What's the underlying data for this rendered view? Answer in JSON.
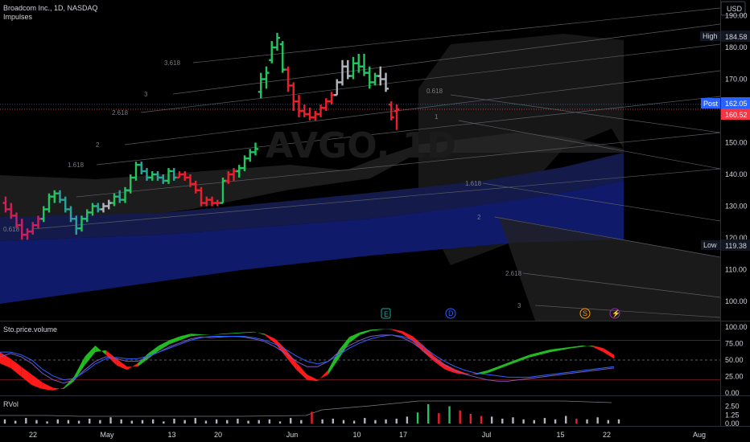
{
  "header": {
    "title": "Broadcom Inc., 1D, NASDAQ",
    "indicator": "Impulses",
    "currency": "USD",
    "watermark": "AVGO, 1D"
  },
  "tags": {
    "high_label": "High",
    "high_value": "184.58",
    "post_label": "Post",
    "post_value": "162.05",
    "last_value": "160.52",
    "low_label": "Low",
    "low_value": "119.38"
  },
  "fib_labels": {
    "up": [
      "0.618",
      "1",
      "1.618",
      "2",
      "2.618",
      "3",
      "3.618"
    ],
    "top": [
      "0.618",
      "1"
    ],
    "down": [
      "1.618",
      "2",
      "2.618",
      "3"
    ]
  },
  "events": {
    "earnings_icon": "E",
    "dividend_icon": "D",
    "split_icon": "S",
    "flash_icon": "⚡"
  },
  "panes": {
    "sto_label": "Sto.price.volume",
    "rvol_label": "RVol"
  },
  "colors": {
    "up": "#22c55e",
    "down": "#ef1c2b",
    "neutral": "#b2b5be",
    "pink": "#cf1f5b",
    "teal": "#26a69a",
    "navy": "#101a6b",
    "sto_green": "#22bb22",
    "sto_red": "#ff1a1a"
  },
  "chart_data": [
    {
      "type": "ohlc",
      "title": "Broadcom Inc., 1D, NASDAQ",
      "ylim": [
        95,
        197
      ],
      "yticks": [
        100,
        110,
        120,
        130,
        140,
        150,
        160,
        170,
        180,
        190
      ],
      "x_tick_labels": [
        "22",
        "May",
        "13",
        "20",
        "Jun",
        "10",
        "17",
        "Jul",
        "15",
        "22",
        "Aug"
      ],
      "x_tick_days": [
        0,
        8,
        15,
        20,
        28,
        35,
        40,
        49,
        57,
        62,
        72
      ],
      "price_lines": {
        "post": 162.05,
        "last": 160.52
      },
      "bars": [
        {
          "o": 131,
          "h": 133,
          "l": 128,
          "c": 129,
          "s": "pink"
        },
        {
          "o": 129,
          "h": 131,
          "l": 126,
          "c": 127,
          "s": "pink"
        },
        {
          "o": 127,
          "h": 128,
          "l": 123,
          "c": 124,
          "s": "pink"
        },
        {
          "o": 124,
          "h": 126,
          "l": 119.4,
          "c": 121,
          "s": "pink"
        },
        {
          "o": 121,
          "h": 123,
          "l": 119.4,
          "c": 122,
          "s": "pink"
        },
        {
          "o": 122,
          "h": 125,
          "l": 121,
          "c": 124,
          "s": "pink"
        },
        {
          "o": 124,
          "h": 127,
          "l": 123,
          "c": 126,
          "s": "pink"
        },
        {
          "o": 126,
          "h": 130,
          "l": 125,
          "c": 129,
          "s": "up"
        },
        {
          "o": 129,
          "h": 134,
          "l": 128,
          "c": 133,
          "s": "up"
        },
        {
          "o": 133,
          "h": 135,
          "l": 131,
          "c": 134,
          "s": "up"
        },
        {
          "o": 134,
          "h": 135,
          "l": 131,
          "c": 132,
          "s": "teal"
        },
        {
          "o": 132,
          "h": 133,
          "l": 128,
          "c": 129,
          "s": "teal"
        },
        {
          "o": 129,
          "h": 130,
          "l": 125,
          "c": 126,
          "s": "teal"
        },
        {
          "o": 126,
          "h": 127,
          "l": 121,
          "c": 123,
          "s": "teal"
        },
        {
          "o": 123,
          "h": 127,
          "l": 122,
          "c": 126,
          "s": "up"
        },
        {
          "o": 126,
          "h": 129,
          "l": 125,
          "c": 128,
          "s": "up"
        },
        {
          "o": 128,
          "h": 131,
          "l": 127,
          "c": 130,
          "s": "up"
        },
        {
          "o": 130,
          "h": 131,
          "l": 128,
          "c": 129,
          "s": "teal"
        },
        {
          "o": 129,
          "h": 131,
          "l": 128,
          "c": 130,
          "s": "neutral"
        },
        {
          "o": 130,
          "h": 132,
          "l": 129,
          "c": 131,
          "s": "neutral"
        },
        {
          "o": 131,
          "h": 134,
          "l": 130,
          "c": 133,
          "s": "up"
        },
        {
          "o": 133,
          "h": 135,
          "l": 131,
          "c": 132,
          "s": "teal"
        },
        {
          "o": 132,
          "h": 136,
          "l": 131,
          "c": 135,
          "s": "up"
        },
        {
          "o": 135,
          "h": 140,
          "l": 134,
          "c": 139,
          "s": "up"
        },
        {
          "o": 139,
          "h": 144,
          "l": 138,
          "c": 143,
          "s": "up"
        },
        {
          "o": 143,
          "h": 144,
          "l": 140,
          "c": 141,
          "s": "teal"
        },
        {
          "o": 141,
          "h": 142,
          "l": 138,
          "c": 139,
          "s": "teal"
        },
        {
          "o": 139,
          "h": 141,
          "l": 138,
          "c": 140,
          "s": "up"
        },
        {
          "o": 140,
          "h": 141,
          "l": 138,
          "c": 139,
          "s": "teal"
        },
        {
          "o": 139,
          "h": 140,
          "l": 137,
          "c": 138,
          "s": "teal"
        },
        {
          "o": 138,
          "h": 142,
          "l": 137,
          "c": 141,
          "s": "up"
        },
        {
          "o": 141,
          "h": 142,
          "l": 138,
          "c": 139,
          "s": "teal"
        },
        {
          "o": 139,
          "h": 141,
          "l": 139,
          "c": 140,
          "s": "down"
        },
        {
          "o": 140,
          "h": 141,
          "l": 138,
          "c": 139,
          "s": "down"
        },
        {
          "o": 139,
          "h": 140,
          "l": 136,
          "c": 137,
          "s": "down"
        },
        {
          "o": 137,
          "h": 138,
          "l": 134,
          "c": 135,
          "s": "down"
        },
        {
          "o": 135,
          "h": 136,
          "l": 130,
          "c": 131,
          "s": "down"
        },
        {
          "o": 131,
          "h": 133,
          "l": 130,
          "c": 132,
          "s": "down"
        },
        {
          "o": 132,
          "h": 133,
          "l": 130,
          "c": 131,
          "s": "down"
        },
        {
          "o": 131,
          "h": 132,
          "l": 130,
          "c": 131,
          "s": "down"
        },
        {
          "o": 131,
          "h": 139,
          "l": 131,
          "c": 138,
          "s": "up"
        },
        {
          "o": 138,
          "h": 141,
          "l": 137,
          "c": 140,
          "s": "down"
        },
        {
          "o": 140,
          "h": 142,
          "l": 138,
          "c": 141,
          "s": "down"
        },
        {
          "o": 141,
          "h": 143,
          "l": 139,
          "c": 142,
          "s": "up"
        },
        {
          "o": 142,
          "h": 146,
          "l": 141,
          "c": 145,
          "s": "up"
        },
        {
          "o": 145,
          "h": 148,
          "l": 144,
          "c": 147,
          "s": "up"
        },
        {
          "o": 147,
          "h": 150,
          "l": 146,
          "c": 148,
          "s": "up"
        },
        {
          "o": 166,
          "h": 172,
          "l": 164,
          "c": 170,
          "s": "up"
        },
        {
          "o": 170,
          "h": 174,
          "l": 167,
          "c": 172,
          "s": "up"
        },
        {
          "o": 176,
          "h": 182,
          "l": 175,
          "c": 180,
          "s": "up"
        },
        {
          "o": 180,
          "h": 184.6,
          "l": 179,
          "c": 183,
          "s": "up"
        },
        {
          "o": 181,
          "h": 182,
          "l": 172,
          "c": 173,
          "s": "up"
        },
        {
          "o": 173,
          "h": 174,
          "l": 166,
          "c": 168,
          "s": "down"
        },
        {
          "o": 168,
          "h": 169,
          "l": 160,
          "c": 163,
          "s": "down"
        },
        {
          "o": 163,
          "h": 165,
          "l": 158,
          "c": 160,
          "s": "down"
        },
        {
          "o": 160,
          "h": 162,
          "l": 158,
          "c": 159,
          "s": "down"
        },
        {
          "o": 159,
          "h": 161,
          "l": 157,
          "c": 158,
          "s": "down"
        },
        {
          "o": 158,
          "h": 160,
          "l": 157,
          "c": 159,
          "s": "down"
        },
        {
          "o": 159,
          "h": 162,
          "l": 158,
          "c": 161,
          "s": "down"
        },
        {
          "o": 161,
          "h": 164,
          "l": 160,
          "c": 163,
          "s": "down"
        },
        {
          "o": 163,
          "h": 166,
          "l": 162,
          "c": 165,
          "s": "down"
        },
        {
          "o": 165,
          "h": 170,
          "l": 165,
          "c": 169,
          "s": "neutral"
        },
        {
          "o": 169,
          "h": 176,
          "l": 168,
          "c": 174,
          "s": "neutral"
        },
        {
          "o": 174,
          "h": 176,
          "l": 170,
          "c": 171,
          "s": "neutral"
        },
        {
          "o": 171,
          "h": 177,
          "l": 170,
          "c": 175,
          "s": "up"
        },
        {
          "o": 175,
          "h": 178,
          "l": 172,
          "c": 174,
          "s": "up"
        },
        {
          "o": 174,
          "h": 178,
          "l": 171,
          "c": 172,
          "s": "up"
        },
        {
          "o": 172,
          "h": 174,
          "l": 167,
          "c": 169,
          "s": "up"
        },
        {
          "o": 169,
          "h": 172,
          "l": 168,
          "c": 171,
          "s": "up"
        },
        {
          "o": 171,
          "h": 174,
          "l": 168,
          "c": 170,
          "s": "neutral"
        },
        {
          "o": 170,
          "h": 172,
          "l": 166,
          "c": 167,
          "s": "neutral"
        },
        {
          "o": 162,
          "h": 163,
          "l": 157,
          "c": 158,
          "s": "down"
        },
        {
          "o": 160,
          "h": 162,
          "l": 154,
          "c": 160.5,
          "s": "down"
        }
      ]
    },
    {
      "type": "area",
      "title": "Sto.price.volume",
      "ylim": [
        0,
        100
      ],
      "yticks": [
        0.0,
        25.0,
        50.0,
        75.0,
        100.0
      ],
      "reference_lines": [
        20,
        50,
        80
      ],
      "series": [
        {
          "values": [
            45,
            38,
            25,
            12,
            6,
            4,
            8,
            25,
            55,
            72,
            58,
            42,
            35,
            45,
            60,
            72,
            80,
            86,
            90,
            89,
            88,
            90,
            91,
            92,
            93,
            88,
            75,
            55,
            35,
            20,
            18,
            35,
            65,
            85,
            92,
            96,
            97,
            96,
            90,
            78,
            62,
            48,
            36,
            30,
            28,
            30,
            34,
            40,
            46,
            52,
            58,
            62,
            66,
            68,
            70,
            72,
            70,
            62,
            52
          ]
        },
        {
          "values": [
            62,
            52,
            40,
            28,
            16,
            8,
            6,
            18,
            42,
            62,
            65,
            52,
            40,
            40,
            52,
            64,
            74,
            80,
            86,
            88,
            88,
            89,
            90,
            91,
            92,
            90,
            82,
            66,
            46,
            28,
            20,
            28,
            52,
            76,
            88,
            94,
            96,
            97,
            94,
            86,
            72,
            56,
            44,
            36,
            30,
            28,
            30,
            36,
            42,
            48,
            54,
            58,
            62,
            65,
            68,
            70,
            72,
            68,
            58
          ]
        },
        {
          "name": "",
          "values": [
            55,
            60,
            55,
            45,
            30,
            20,
            15,
            20,
            35,
            48,
            55,
            52,
            48,
            48,
            55,
            62,
            70,
            76,
            82,
            85,
            84,
            85,
            86,
            85,
            82,
            78,
            70,
            60,
            48,
            40,
            40,
            48,
            62,
            72,
            80,
            86,
            88,
            88,
            84,
            76,
            64,
            52,
            42,
            34,
            28,
            24,
            20,
            18,
            18,
            20,
            22,
            24,
            26,
            28,
            30,
            32,
            34,
            36,
            38
          ]
        },
        {
          "name": "",
          "values": [
            62,
            62,
            58,
            50,
            36,
            26,
            20,
            22,
            32,
            44,
            52,
            54,
            52,
            52,
            56,
            62,
            68,
            74,
            80,
            84,
            86,
            86,
            86,
            86,
            84,
            80,
            74,
            66,
            56,
            48,
            44,
            48,
            58,
            68,
            76,
            82,
            86,
            88,
            86,
            80,
            70,
            58,
            48,
            40,
            34,
            30,
            28,
            26,
            24,
            24,
            24,
            26,
            28,
            30,
            32,
            34,
            36,
            38,
            40
          ]
        }
      ]
    },
    {
      "type": "bar",
      "title": "RVol",
      "ylim": [
        0,
        3
      ],
      "yticks": [
        0.0,
        1.25,
        2.5
      ],
      "values": [
        0.6,
        0.4,
        0.8,
        0.5,
        0.3,
        0.6,
        0.5,
        0.4,
        0.7,
        0.5,
        0.9,
        0.6,
        0.4,
        0.5,
        0.6,
        0.3,
        0.7,
        0.5,
        0.8,
        0.4,
        0.6,
        0.5,
        0.7,
        0.4,
        0.5,
        0.6,
        0.3,
        0.8,
        0.5,
        1.7,
        0.6,
        0.7,
        0.5,
        0.4,
        0.8,
        0.5,
        0.6,
        0.7,
        1.0,
        1.6,
        2.8,
        1.5,
        2.5,
        1.9,
        1.4,
        1.1,
        1.0,
        0.7,
        0.9,
        0.6,
        0.5,
        0.8,
        0.6,
        1.1,
        0.7,
        0.6,
        0.9,
        0.5,
        0.6
      ],
      "colors": [
        "neutral",
        "neutral",
        "neutral",
        "neutral",
        "neutral",
        "neutral",
        "neutral",
        "neutral",
        "neutral",
        "neutral",
        "neutral",
        "neutral",
        "neutral",
        "neutral",
        "neutral",
        "neutral",
        "neutral",
        "neutral",
        "neutral",
        "neutral",
        "neutral",
        "neutral",
        "neutral",
        "neutral",
        "neutral",
        "neutral",
        "neutral",
        "neutral",
        "neutral",
        "down",
        "neutral",
        "neutral",
        "neutral",
        "neutral",
        "neutral",
        "neutral",
        "neutral",
        "neutral",
        "neutral",
        "up",
        "up",
        "down",
        "up",
        "down",
        "down",
        "down",
        "neutral",
        "neutral",
        "neutral",
        "neutral",
        "neutral",
        "neutral",
        "neutral",
        "neutral",
        "down",
        "neutral",
        "neutral",
        "neutral",
        "neutral"
      ]
    }
  ]
}
